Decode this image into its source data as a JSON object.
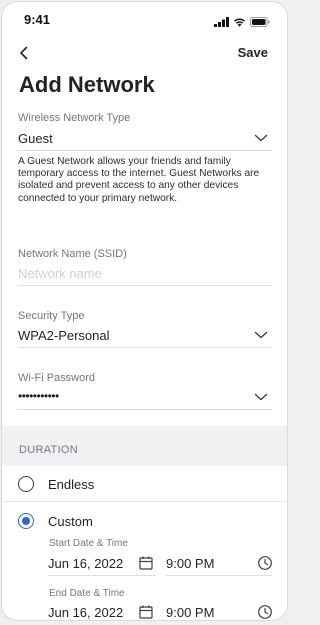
{
  "status": {
    "time": "9:41"
  },
  "nav": {
    "save_label": "Save"
  },
  "page": {
    "title": "Add Network"
  },
  "network_type": {
    "label": "Wireless Network Type",
    "value": "Guest",
    "description": "A Guest Network allows your friends and family temporary access to the internet. Guest Networks are isolated and prevent access to any other devices connected to your primary network."
  },
  "ssid": {
    "label": "Network Name (SSID)",
    "placeholder": "Network name"
  },
  "security": {
    "label": "Security Type",
    "value": "WPA2-Personal"
  },
  "password": {
    "label": "Wi-Fi Password",
    "value": "•••••••••••"
  },
  "duration": {
    "header": "DURATION",
    "options": [
      {
        "label": "Endless",
        "selected": false
      },
      {
        "label": "Custom",
        "selected": true
      }
    ],
    "start": {
      "label": "Start Date & Time",
      "date": "Jun 16, 2022",
      "time": "9:00 PM"
    },
    "end": {
      "label": "End Date & Time",
      "date": "Jun 16, 2022",
      "time": "9:00 PM"
    }
  },
  "colors": {
    "accent": "#2d6bbd",
    "text": "#1f2227",
    "muted": "#717780"
  }
}
